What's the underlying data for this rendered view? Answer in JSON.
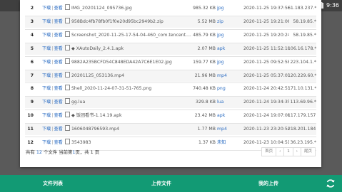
{
  "status_bar": {
    "time": "9:36"
  },
  "table": {
    "rows": [
      {
        "idx": "2",
        "download": "下载",
        "view": "查看",
        "name": "IMG_20201124_095736.jpg",
        "size": "985.32 KB",
        "type": "jpg",
        "time": "2020-11-25 19:37:56",
        "md5": "61.183.237.*"
      },
      {
        "idx": "3",
        "download": "下载",
        "view": "查看",
        "name": "958Bdc4fb78fb0f1f0e20d95bc2949b2.zip",
        "size": "5.52 MB",
        "type": "zip",
        "time": "2020-11-25 19:21:06",
        "md5": "58.19.85.*"
      },
      {
        "idx": "4",
        "download": "下载",
        "view": "查看",
        "name": "Screenshot_2020-11-25-17-54-04-460_com.tencent....",
        "size": "485.79 KB",
        "type": "jpg",
        "time": "2020-11-25 19:20:24",
        "md5": "58.19.85.*"
      },
      {
        "idx": "5",
        "download": "下载",
        "view": "查看",
        "name": "◆ XAutoDaily_2.4.1.apk",
        "size": "2.07 MB",
        "type": "apk",
        "time": "2020-11-25 11:52:10",
        "md5": "106.16.178.*"
      },
      {
        "idx": "6",
        "download": "下载",
        "view": "查看",
        "name": "9882A235BCFD54C848EDA42A7C6E1E02.jpg",
        "size": "159.77 KB",
        "type": "jpg",
        "time": "2020-11-25 09:52:58",
        "md5": "223.104.1.*"
      },
      {
        "idx": "7",
        "download": "下载",
        "view": "查看",
        "name": "20201125_053136.mp4",
        "size": "21.96 MB",
        "type": "mp4",
        "time": "2020-11-25 05:37:03",
        "md5": "120.229.60.*"
      },
      {
        "idx": "8",
        "download": "下载",
        "view": "查看",
        "name": "Shell_2020-11-24-07-31-51-765.png",
        "size": "740.48 KB",
        "type": "png",
        "time": "2020-11-24 20:42:53",
        "md5": "171.10.131.*"
      },
      {
        "idx": "9",
        "download": "下载",
        "view": "查看",
        "name": "gg.lua",
        "size": "329.8 KB",
        "type": "lua",
        "time": "2020-11-24 19:34:35",
        "md5": "113.69.96.*"
      },
      {
        "idx": "10",
        "download": "下载",
        "view": "查看",
        "name": "◆ 饭团看书-1.14.19.apk",
        "size": "23.42 MB",
        "type": "apk",
        "time": "2020-11-24 19:07:08",
        "md5": "117.179.157.*"
      },
      {
        "idx": "11",
        "download": "下载",
        "view": "查看",
        "name": "1606048796593.mp4",
        "size": "1.77 MB",
        "type": "mp4",
        "time": "2020-11-23 23:20:54",
        "md5": "218.201.184.*"
      },
      {
        "idx": "12",
        "download": "下载",
        "view": "查看",
        "name": "3543983",
        "size": "1.37 KB",
        "type": "未知",
        "time": "2020-11-23 10:04:51",
        "md5": "36.23.195.*"
      }
    ]
  },
  "footer": {
    "prefix": "共有",
    "count": "12",
    "mid": "个文件 当前第",
    "page": "1",
    "suffix": "页，共 1 页"
  },
  "pager": {
    "first": "首页",
    "prev": "‹",
    "current": "1",
    "next": "›",
    "last": "尾页"
  },
  "bottom_nav": {
    "tab1": "文件列表",
    "tab2": "上传文件",
    "tab3": "我的上传"
  },
  "colors": {
    "accent": "#129a74",
    "link": "#2a6cc3"
  }
}
